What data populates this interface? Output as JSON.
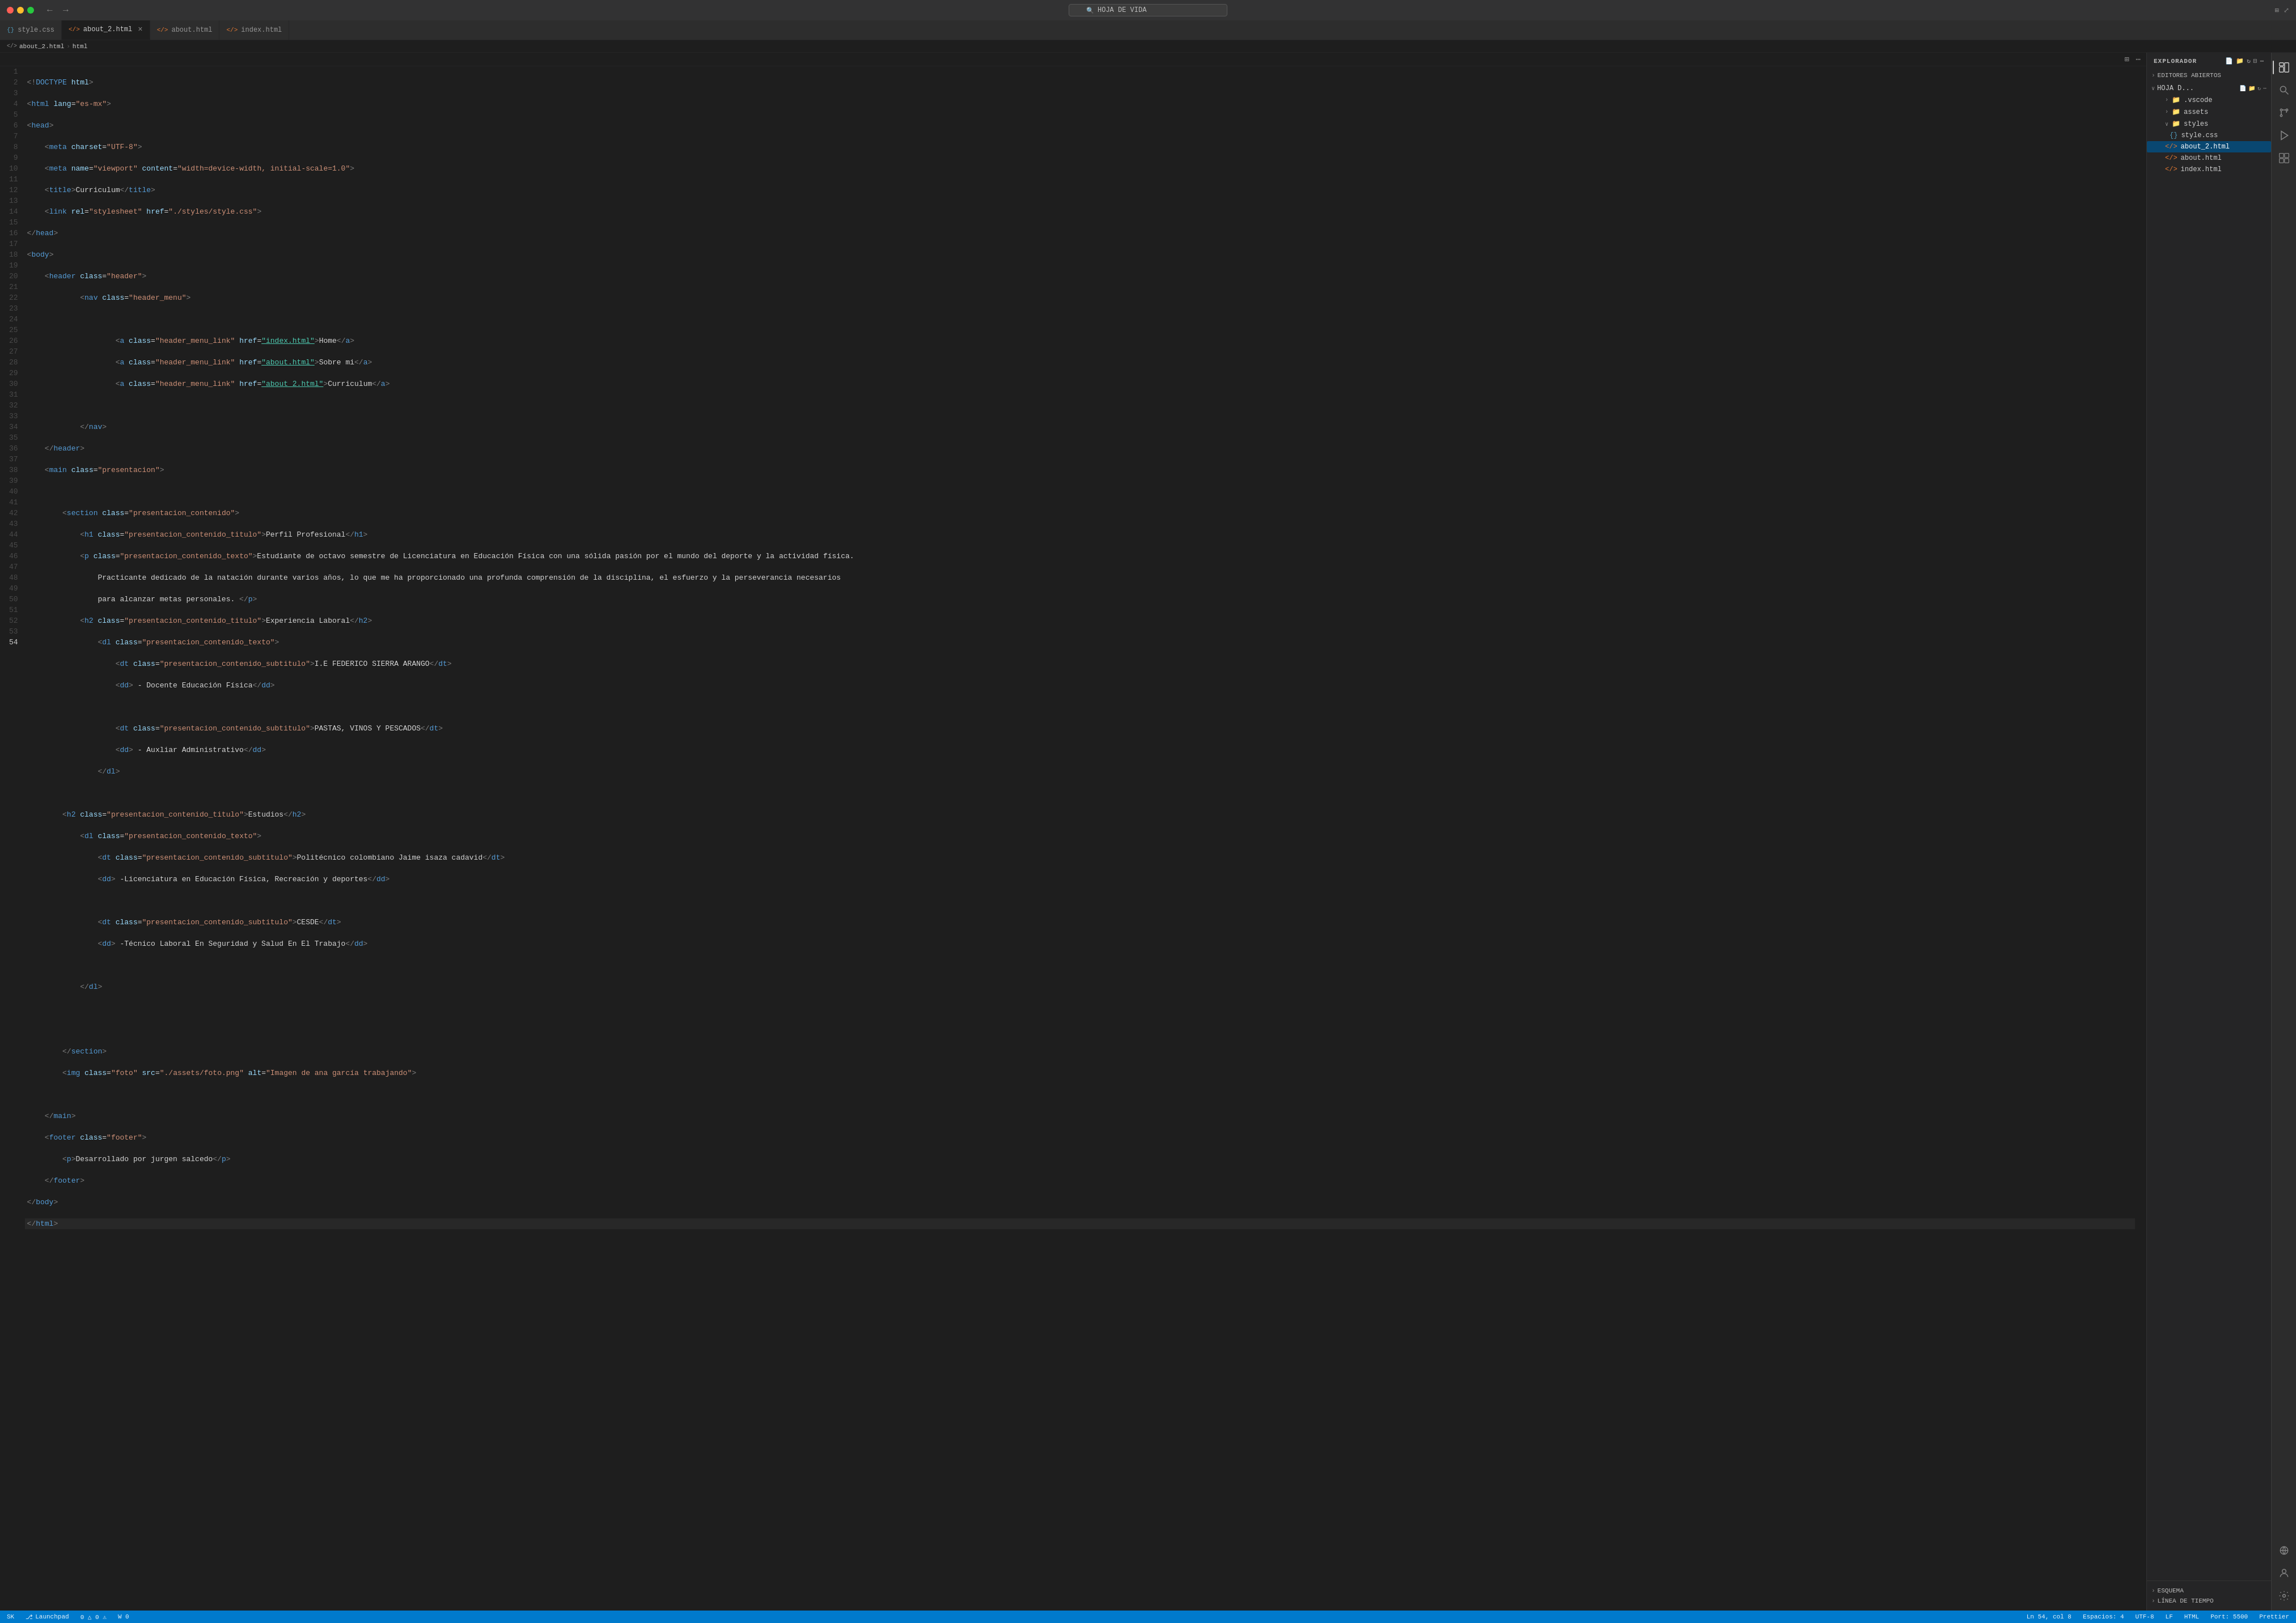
{
  "window": {
    "title": "HOJA DE VIDA"
  },
  "titlebar": {
    "back_label": "←",
    "forward_label": "→",
    "search_placeholder": "HOJA DE VIDA"
  },
  "tabs": [
    {
      "id": "style-css",
      "label": "style.css",
      "icon": "{}",
      "type": "css",
      "active": false,
      "modified": false
    },
    {
      "id": "about-2-html",
      "label": "about_2.html",
      "icon": "</>",
      "type": "html",
      "active": true,
      "modified": true
    },
    {
      "id": "about-html",
      "label": "about.html",
      "icon": "</>",
      "type": "html",
      "active": false,
      "modified": false
    },
    {
      "id": "index-html",
      "label": "index.html",
      "icon": "</>",
      "type": "html",
      "active": false,
      "modified": false
    }
  ],
  "breadcrumb": {
    "parts": [
      "about_2.html",
      ">",
      "html"
    ]
  },
  "editor_icons": {
    "split": "⊞",
    "more": "⋯"
  },
  "code_lines": [
    {
      "num": 1,
      "content": "<!DOCTYPE html>"
    },
    {
      "num": 2,
      "content": "<html lang=\"es-mx\">"
    },
    {
      "num": 3,
      "content": "<head>"
    },
    {
      "num": 4,
      "content": "        <meta charset=\"UTF-8\">"
    },
    {
      "num": 5,
      "content": "        <meta name=\"viewport\" content=\"width=device-width, initial-scale=1.0\">"
    },
    {
      "num": 6,
      "content": "        <title>Curriculum</title>"
    },
    {
      "num": 7,
      "content": "        <link rel=\"stylesheet\" href=\"./styles/style.css\">"
    },
    {
      "num": 8,
      "content": "    </head>"
    },
    {
      "num": 9,
      "content": "    <body>"
    },
    {
      "num": 10,
      "content": "        <header class=\"header\">"
    },
    {
      "num": 11,
      "content": "                <nav class=\"header_menu\">"
    },
    {
      "num": 12,
      "content": ""
    },
    {
      "num": 13,
      "content": "                        <a class=\"header_menu_link\" href=\"index.html\">Home</a>"
    },
    {
      "num": 14,
      "content": "                        <a class=\"header_menu_link\" href=\"about.html\">Sobre mi</a>"
    },
    {
      "num": 15,
      "content": "                        <a class=\"header_menu_link\" href=\"about_2.html\">Curriculum</a>"
    },
    {
      "num": 16,
      "content": ""
    },
    {
      "num": 17,
      "content": "                </nav>"
    },
    {
      "num": 18,
      "content": "        </header>"
    },
    {
      "num": 19,
      "content": "        <main class=\"presentacion\">"
    },
    {
      "num": 20,
      "content": ""
    },
    {
      "num": 21,
      "content": "            <section class=\"presentacion_contenido\">"
    },
    {
      "num": 22,
      "content": "                <h1 class=\"presentacion_contenido_titulo\">Perfil Profesional</h1>"
    },
    {
      "num": 23,
      "content": "                <p class=\"presentacion_contenido_texto\">Estudiante de octavo semestre de Licenciatura en Educación Física con una sólida pasión por el mundo del deporte y la actividad física."
    },
    {
      "num": 24,
      "content": "                    Practicante dedicado de la natación durante varios años, lo que me ha proporcionado una profunda comprensión de la disciplina, el esfuerzo y la perseverancia necesarios"
    },
    {
      "num": 25,
      "content": "                    para alcanzar metas personales. </p>"
    },
    {
      "num": 26,
      "content": "                <h2 class=\"presentacion_contenido_titulo\">Experiencia Laboral</h2>"
    },
    {
      "num": 27,
      "content": "                    <dl class=\"presentacion_contenido_texto\">"
    },
    {
      "num": 28,
      "content": "                        <dt class=\"presentacion_contenido_subtitulo\">I.E FEDERICO SIERRA ARANGO</dt>"
    },
    {
      "num": 29,
      "content": "                        <dd> - Docente Educación Física</dd>"
    },
    {
      "num": 30,
      "content": ""
    },
    {
      "num": 31,
      "content": "                        <dt class=\"presentacion_contenido_subtitulo\">PASTAS, VINOS Y PESCADOS</dt>"
    },
    {
      "num": 32,
      "content": "                        <dd> - Auxliar Administrativo</dd>"
    },
    {
      "num": 33,
      "content": "                    </dl>"
    },
    {
      "num": 34,
      "content": ""
    },
    {
      "num": 35,
      "content": "            <h2 class=\"presentacion_contenido_titulo\">Estudios</h2>"
    },
    {
      "num": 36,
      "content": "                <dl class=\"presentacion_contenido_texto\">"
    },
    {
      "num": 37,
      "content": "                    <dt class=\"presentacion_contenido_subtitulo\">Politécnico colombiano Jaime isaza cadavid</dt>"
    },
    {
      "num": 38,
      "content": "                    <dd> -Licenciatura en Educación Física, Recreación y deportes</dd>"
    },
    {
      "num": 39,
      "content": ""
    },
    {
      "num": 40,
      "content": "                    <dt class=\"presentacion_contenido_subtitulo\">CESDE</dt>"
    },
    {
      "num": 41,
      "content": "                    <dd> -Técnico Laboral En Seguridad y Salud En El Trabajo</dd>"
    },
    {
      "num": 42,
      "content": ""
    },
    {
      "num": 43,
      "content": "                </dl>"
    },
    {
      "num": 44,
      "content": ""
    },
    {
      "num": 45,
      "content": ""
    },
    {
      "num": 46,
      "content": "            </section>"
    },
    {
      "num": 47,
      "content": "            <img class=\"foto\" src=\"./assets/foto.png\" alt=\"Imagen de ana garcía trabajando\">"
    },
    {
      "num": 48,
      "content": ""
    },
    {
      "num": 49,
      "content": "        </main>"
    },
    {
      "num": 50,
      "content": "        <footer class=\"footer\">"
    },
    {
      "num": 51,
      "content": "            <p>Desarrollado por jurgen salcedo</p>"
    },
    {
      "num": 52,
      "content": "        </footer>"
    },
    {
      "num": 53,
      "content": "    </body>"
    },
    {
      "num": 54,
      "content": "</html>"
    }
  ],
  "sidebar": {
    "explorer_header": "EXPLORADOR",
    "open_editors_label": "EDITORES ABIERTOS",
    "project_label": "HOJA D...",
    "sections": [
      {
        "id": "vscode",
        "label": ".vscode",
        "type": "folder",
        "indent": 1
      },
      {
        "id": "assets",
        "label": "assets",
        "type": "folder",
        "indent": 1
      },
      {
        "id": "styles",
        "label": "styles",
        "type": "folder",
        "indent": 1,
        "expanded": true
      },
      {
        "id": "style-css",
        "label": "style.css",
        "type": "css",
        "indent": 2
      },
      {
        "id": "about2-html",
        "label": "about_2.html",
        "type": "html",
        "indent": 1,
        "active": true
      },
      {
        "id": "about-html",
        "label": "about.html",
        "type": "html",
        "indent": 1
      },
      {
        "id": "index-html",
        "label": "index.html",
        "type": "html",
        "indent": 1
      }
    ],
    "bottom_sections": [
      {
        "id": "esquema",
        "label": "ESQUEMA"
      },
      {
        "id": "linea-de-tiempo",
        "label": "LÍNEA DE TIEMPO"
      }
    ]
  },
  "activity_bar": {
    "icons": [
      {
        "id": "explorer",
        "symbol": "📄",
        "active": true
      },
      {
        "id": "search",
        "symbol": "🔍",
        "active": false
      },
      {
        "id": "git",
        "symbol": "⎇",
        "active": false
      },
      {
        "id": "debug",
        "symbol": "▷",
        "active": false
      },
      {
        "id": "extensions",
        "symbol": "⧉",
        "active": false
      },
      {
        "id": "remote",
        "symbol": "⊕",
        "active": false
      },
      {
        "id": "accounts",
        "symbol": "👤",
        "active": false
      },
      {
        "id": "settings",
        "symbol": "⚙",
        "active": false
      }
    ]
  },
  "statusbar": {
    "left_items": [
      "SK",
      "⎇",
      "0 △ 0 ⚠",
      "W 0"
    ],
    "git_branch": "Launchpad",
    "right_items": [
      "Ln 54, col 8",
      "Espacios: 4",
      "UTF-8",
      "LF",
      "HTML",
      "Port: 5500",
      "Prettier"
    ]
  }
}
